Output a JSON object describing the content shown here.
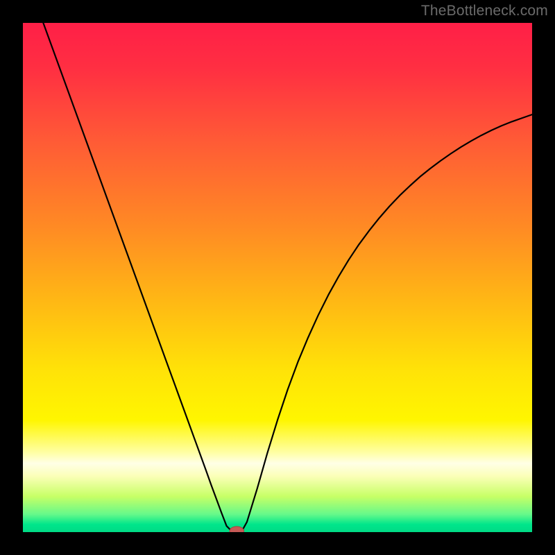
{
  "watermark": "TheBottleneck.com",
  "colors": {
    "frame": "#000000",
    "gradient_stops": [
      {
        "offset": 0.0,
        "color": "#ff1f47"
      },
      {
        "offset": 0.09,
        "color": "#ff2f42"
      },
      {
        "offset": 0.23,
        "color": "#ff5a36"
      },
      {
        "offset": 0.4,
        "color": "#ff8a24"
      },
      {
        "offset": 0.55,
        "color": "#ffb914"
      },
      {
        "offset": 0.68,
        "color": "#ffe208"
      },
      {
        "offset": 0.78,
        "color": "#fff600"
      },
      {
        "offset": 0.845,
        "color": "#ffffa8"
      },
      {
        "offset": 0.865,
        "color": "#ffffe6"
      },
      {
        "offset": 0.89,
        "color": "#fbffb8"
      },
      {
        "offset": 0.93,
        "color": "#c7ff66"
      },
      {
        "offset": 0.965,
        "color": "#66f98a"
      },
      {
        "offset": 0.985,
        "color": "#00e68b"
      },
      {
        "offset": 1.0,
        "color": "#00db85"
      }
    ],
    "curve": "#000000",
    "marker_fill": "#c55a56",
    "marker_stroke": "#a24640"
  },
  "chart_data": {
    "type": "line",
    "title": "",
    "xlabel": "",
    "ylabel": "",
    "xlim": [
      0,
      100
    ],
    "ylim": [
      0,
      100
    ],
    "legend": false,
    "grid": false,
    "series": [
      {
        "name": "bottleneck-curve",
        "x": [
          4,
          6,
          8,
          10,
          12,
          14,
          16,
          18,
          20,
          22,
          24,
          26,
          28,
          30,
          32,
          34,
          36,
          37,
          38,
          39,
          40,
          41,
          42,
          43,
          44,
          46,
          48,
          50,
          52,
          54,
          56,
          58,
          60,
          62,
          64,
          66,
          68,
          70,
          72,
          74,
          76,
          78,
          80,
          82,
          84,
          86,
          88,
          90,
          92,
          94,
          96,
          98,
          100
        ],
        "y": [
          100,
          94.5,
          89,
          83.5,
          78,
          72.5,
          67,
          61.5,
          56,
          50.5,
          45,
          39.5,
          34,
          28.5,
          23,
          17.5,
          12,
          9.2,
          6.5,
          3.8,
          1.2,
          0.2,
          0.0,
          0.2,
          2.0,
          8.5,
          15.5,
          22.0,
          28.0,
          33.4,
          38.2,
          42.6,
          46.6,
          50.2,
          53.5,
          56.5,
          59.2,
          61.7,
          64.0,
          66.1,
          68.0,
          69.8,
          71.4,
          72.9,
          74.3,
          75.6,
          76.8,
          77.9,
          78.9,
          79.8,
          80.6,
          81.3,
          82.0
        ]
      }
    ],
    "marker": {
      "x": 42,
      "y": 0.2,
      "rx": 1.4,
      "ry": 0.9
    }
  }
}
